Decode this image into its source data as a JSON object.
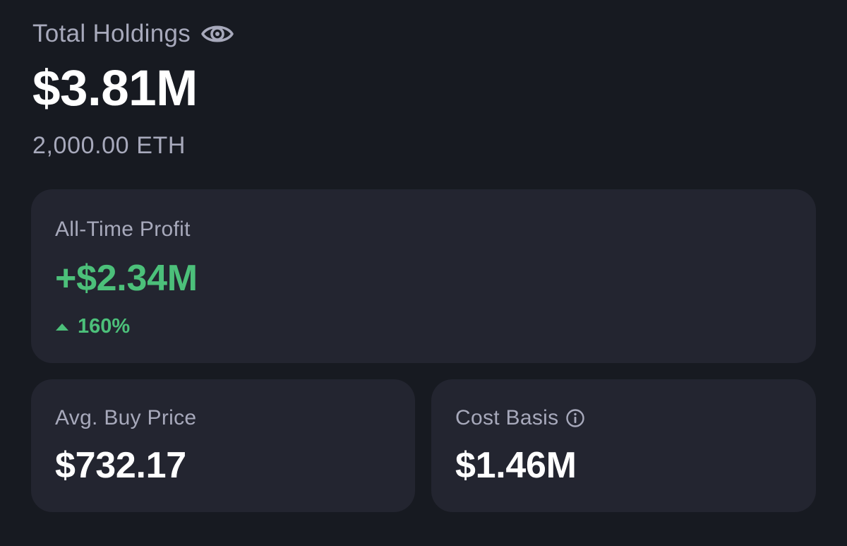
{
  "holdings": {
    "title": "Total Holdings",
    "visibility_icon": "eye-icon",
    "value": "$3.81M",
    "eth_amount": "2,000.00 ETH"
  },
  "profit": {
    "label": "All-Time Profit",
    "value": "+$2.34M",
    "trend_icon": "up-arrow-icon",
    "percent": "160%"
  },
  "avg_buy": {
    "label": "Avg. Buy Price",
    "value": "$732.17"
  },
  "cost_basis": {
    "label": "Cost Basis",
    "info_icon": "info-icon",
    "value": "$1.46M"
  },
  "colors": {
    "background": "#171a21",
    "card": "#232530",
    "muted_text": "#a7a9bb",
    "positive": "#4cc07a",
    "primary_text": "#ffffff"
  }
}
